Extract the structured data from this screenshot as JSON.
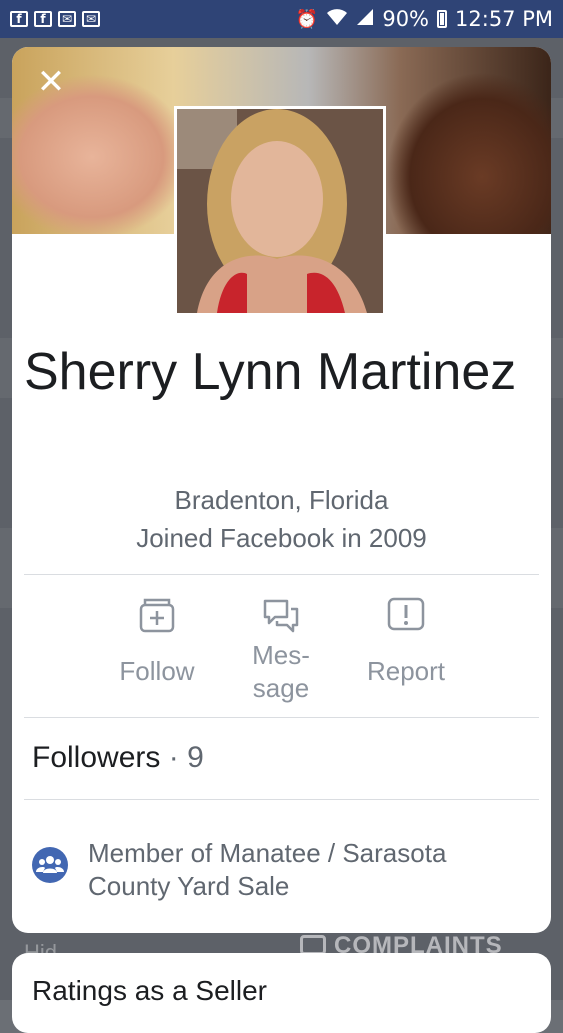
{
  "status_bar": {
    "left_icons": [
      "facebook-icon",
      "facebook-icon",
      "mail-icon",
      "mail-icon"
    ],
    "right_icons": [
      "alarm-icon",
      "wifi-icon",
      "signal-icon"
    ],
    "battery": "90%",
    "time": "12:57 PM"
  },
  "profile": {
    "name": "Sherry Lynn Martinez",
    "location": "Bradenton, Florida",
    "joined": "Joined Facebook in 2009"
  },
  "actions": {
    "follow": "Follow",
    "message_line1": "Mes-",
    "message_line2": "sage",
    "report": "Report"
  },
  "followers": {
    "label": "Followers",
    "separator": "·",
    "count": "9"
  },
  "group": {
    "line1": "Member of Manatee / Sarasota",
    "line2": "County Yard Sale"
  },
  "next_card": {
    "title": "Ratings as a Seller"
  },
  "watermark": "COMPLAINTS",
  "colors": {
    "status_bar": "#2f4476",
    "accent": "#4267b2",
    "text_primary": "#1c1e21",
    "text_secondary": "#606770",
    "icon_gray": "#8d949e"
  }
}
